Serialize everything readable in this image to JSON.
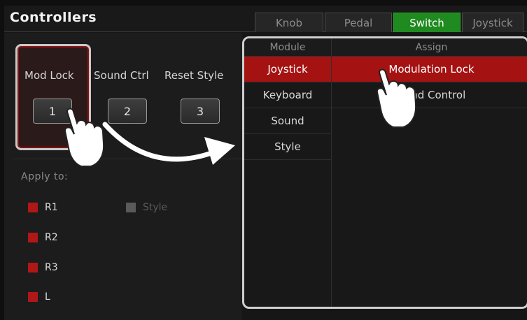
{
  "header": {
    "title": "Controllers",
    "tabs": [
      {
        "label": "Knob",
        "active": false
      },
      {
        "label": "Pedal",
        "active": false
      },
      {
        "label": "Switch",
        "active": true
      },
      {
        "label": "Joystick",
        "active": false
      }
    ]
  },
  "switch_slots": [
    {
      "label": "Mod Lock",
      "button": "1",
      "selected": true
    },
    {
      "label": "Sound Ctrl",
      "button": "2",
      "selected": false
    },
    {
      "label": "Reset Style",
      "button": "3",
      "selected": false
    }
  ],
  "apply_to": {
    "label": "Apply to:",
    "items": [
      {
        "label": "R1",
        "checked": true
      },
      {
        "label": "Style",
        "checked": false
      },
      {
        "label": "R2",
        "checked": true
      },
      {
        "label": "R3",
        "checked": true
      },
      {
        "label": "L",
        "checked": true
      }
    ]
  },
  "module_list": {
    "header": "Module",
    "items": [
      {
        "label": "Joystick",
        "selected": true
      },
      {
        "label": "Keyboard",
        "selected": false
      },
      {
        "label": "Sound",
        "selected": false
      },
      {
        "label": "Style",
        "selected": false
      }
    ]
  },
  "assign_list": {
    "header": "Assign",
    "items": [
      {
        "label": "Modulation Lock",
        "selected": true
      },
      {
        "label": "Bend Control",
        "selected": false
      }
    ]
  },
  "colors": {
    "active_tab": "#1f8a1f",
    "selected_row": "#a51212",
    "checkbox_on": "#b01818",
    "checkbox_off": "#5a5a5a",
    "highlight_frame": "#cfcfcf"
  },
  "icons": [
    "hand-pointer-icon",
    "curved-arrow-icon"
  ]
}
